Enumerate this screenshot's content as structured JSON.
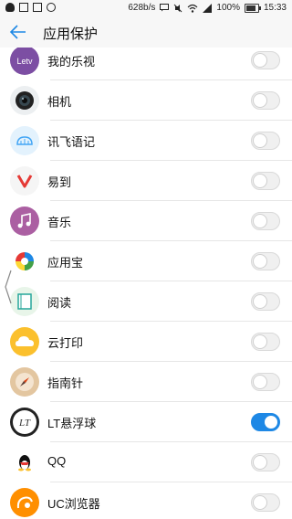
{
  "status_bar": {
    "network_speed": "628b/s",
    "battery": "100%",
    "time": "15:33"
  },
  "header": {
    "title": "应用保护"
  },
  "apps": [
    {
      "name": "我的乐视",
      "icon": "letv-icon",
      "enabled": false
    },
    {
      "name": "相机",
      "icon": "camera-icon",
      "enabled": false
    },
    {
      "name": "讯飞语记",
      "icon": "iflytek-note-icon",
      "enabled": false
    },
    {
      "name": "易到",
      "icon": "yidao-icon",
      "enabled": false
    },
    {
      "name": "音乐",
      "icon": "music-icon",
      "enabled": false
    },
    {
      "name": "应用宝",
      "icon": "app-store-icon",
      "enabled": false
    },
    {
      "name": "阅读",
      "icon": "reader-icon",
      "enabled": false
    },
    {
      "name": "云打印",
      "icon": "cloud-print-icon",
      "enabled": false
    },
    {
      "name": "指南针",
      "icon": "compass-icon",
      "enabled": false
    },
    {
      "name": "LT悬浮球",
      "icon": "lt-float-ball-icon",
      "enabled": true
    },
    {
      "name": "QQ",
      "icon": "qq-icon",
      "enabled": false
    },
    {
      "name": "UC浏览器",
      "icon": "uc-browser-icon",
      "enabled": false
    }
  ],
  "colors": {
    "accent": "#1e88e5",
    "toggle_off": "#f0f0f0",
    "divider": "#e6e6e6"
  }
}
